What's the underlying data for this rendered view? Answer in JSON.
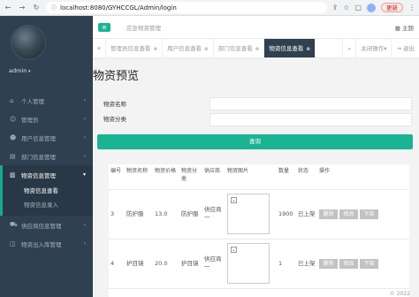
{
  "browser": {
    "url": "localhost:8080/GYHCCGL/Admin/login",
    "update_label": "更新"
  },
  "sidebar": {
    "user_name": "admin",
    "items": [
      {
        "label": "个人管理",
        "icon": "home-icon"
      },
      {
        "label": "管理员",
        "icon": "user-icon"
      },
      {
        "label": "用户信息管理",
        "icon": "users-icon"
      },
      {
        "label": "部门信息管理",
        "icon": "document-icon"
      },
      {
        "label": "物资信息管理",
        "icon": "book-icon"
      },
      {
        "label": "供应商信息管理",
        "icon": "truck-icon"
      },
      {
        "label": "物资出入库管理",
        "icon": "box-icon"
      }
    ],
    "submenu": [
      {
        "label": "物资信息查看"
      },
      {
        "label": "物资信息录入"
      }
    ]
  },
  "header": {
    "system_title": "应急物资管理",
    "theme_label": "主题"
  },
  "tabs": {
    "items": [
      {
        "label": "管理员信息查看"
      },
      {
        "label": "用户信息查看"
      },
      {
        "label": "部门信息查看"
      },
      {
        "label": "物资信息查看"
      }
    ],
    "close_ops_label": "关闭操作",
    "exit_label": "退出"
  },
  "main": {
    "page_title": "物资预览",
    "name_label": "物资名称",
    "category_label": "物资分类",
    "query_label": "查询",
    "columns": [
      "编号",
      "物资名称",
      "物资价格",
      "物资分类",
      "供应商",
      "物资图片",
      "数量",
      "状态",
      "操作"
    ],
    "rows": [
      {
        "id": "3",
        "name": "防护服",
        "price": "13.0",
        "category": "防护服",
        "supplier": "供应商一",
        "quantity": "1900",
        "status": "已上架"
      },
      {
        "id": "4",
        "name": "护目镜",
        "price": "20.0",
        "category": "护目镜",
        "supplier": "供应商一",
        "quantity": "1",
        "status": "已上架"
      }
    ],
    "delete_label": "删除",
    "edit_label": "修改",
    "offshelf_label": "下架"
  },
  "footer": {
    "text": "© 2022"
  }
}
